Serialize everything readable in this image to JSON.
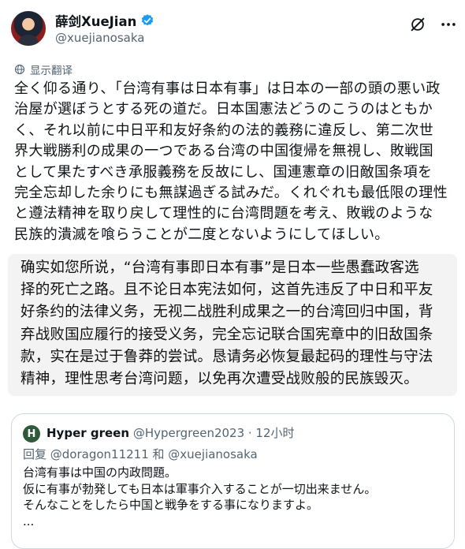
{
  "author": {
    "display_name": "薛剑XueJian",
    "handle": "@xuejianosaka"
  },
  "translate": {
    "label": "显示翻译"
  },
  "post": {
    "jp_text": "全く仰る通り、「台湾有事は日本有事」は日本の一部の頭の悪い政\n治屋が選ぼうとする死の道だ。日本国憲法どうのこうのはともか\nく、それ以前に中日平和友好条約の法的義務に違反し、第二次世\n界大戦勝利の成果の一つである台湾の中国復帰を無視し、敗戦国\nとして果たすべき承服義務を反故にし、国連憲章の旧敵国条項を\n完全忘却した余りにも無謀過ぎる試みだ。くれぐれも最低限の理性\nと遵法精神を取り戻して理性的に台湾問題を考え、敗戦のような\n民族的潰滅を喰らうことが二度とないようにしてほしい。",
    "cn_text": "确实如您所说，“台湾有事即日本有事”是日本一些愚蠢政客选\n择的死亡之路。且不论日本宪法如何，这首先违反了中日和平友\n好条约的法律义务，无视二战胜利成果之一的台湾回归中国，背\n弃战败国应履行的接受义务，完全忘记联合国宪章中的旧敌国条\n款，实在是过于鲁莽的尝试。恳请务必恢复最起码的理性与守法\n精神，理性思考台湾问题，以免再次遭受战败般的民族毁灭。"
  },
  "quoted": {
    "avatar_letter": "H",
    "name": "Hyper green",
    "meta": "@Hypergreen2023 · 12小时",
    "reply_to": "回复 @doragon11211 和 @xuejianosaka",
    "body": "台湾有事は中国の内政問題。\n仮に有事が勃発しても日本は軍事介入することが一切出来ません。\nそんなことをしたら中国と戦争をする事になりますよ。\n..."
  },
  "colors": {
    "verified": "#1d9bf0",
    "secondary_text": "#536471",
    "border": "#cfd9de",
    "highlight_bg": "#f3f3f4"
  },
  "icons": [
    "verified-icon",
    "grok-icon",
    "more-icon",
    "globe-icon"
  ]
}
